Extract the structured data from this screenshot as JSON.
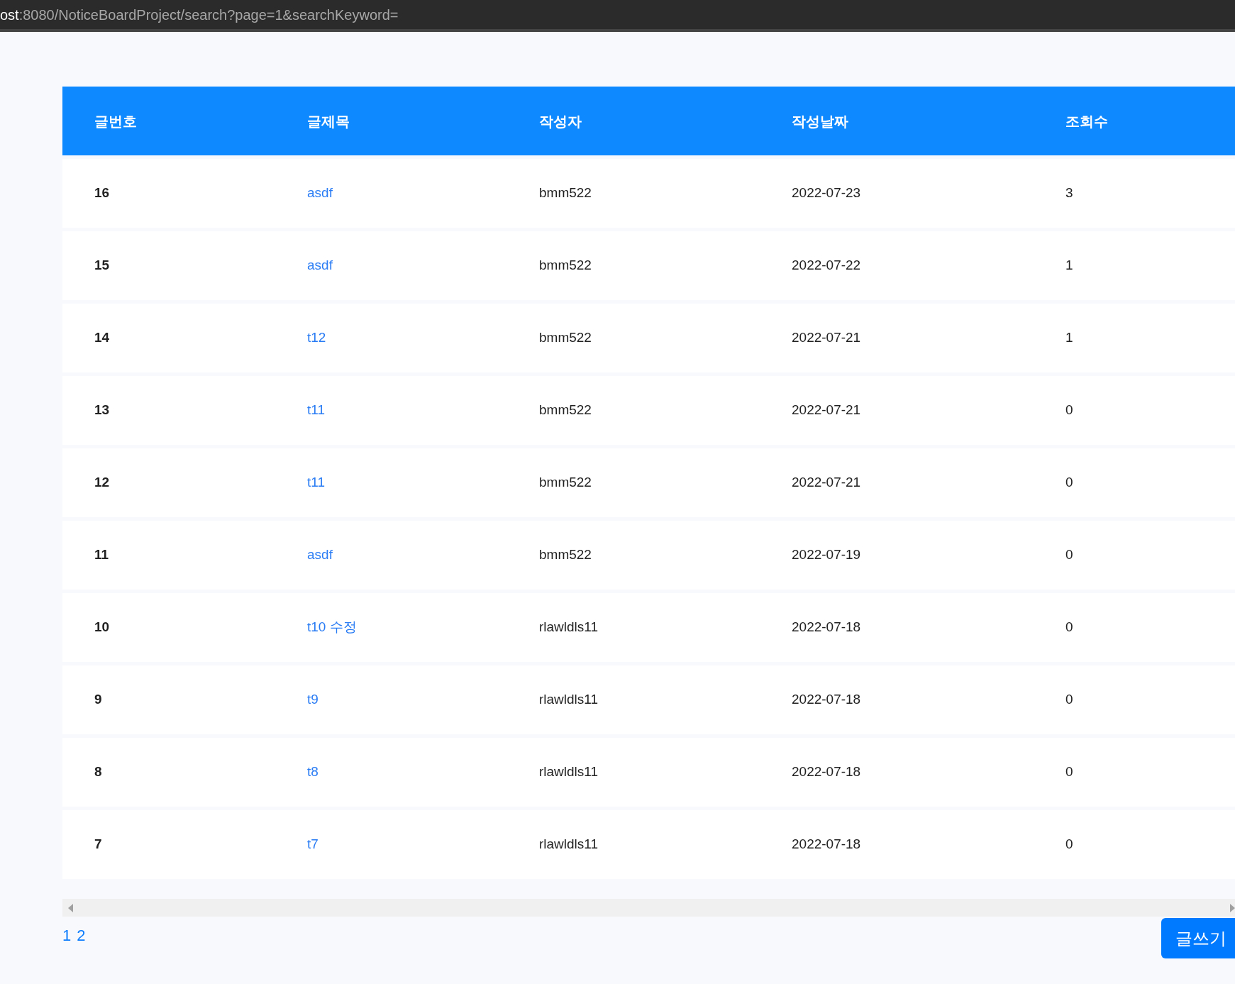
{
  "address_bar": {
    "host": "ost",
    "path": ":8080/NoticeBoardProject/search?page=1&searchKeyword="
  },
  "table": {
    "columns": [
      "글번호",
      "글제목",
      "작성자",
      "작성날짜",
      "조회수"
    ],
    "rows": [
      {
        "number": "16",
        "title": "asdf",
        "author": "bmm522",
        "date": "2022-07-23",
        "views": "3"
      },
      {
        "number": "15",
        "title": "asdf",
        "author": "bmm522",
        "date": "2022-07-22",
        "views": "1"
      },
      {
        "number": "14",
        "title": "t12",
        "author": "bmm522",
        "date": "2022-07-21",
        "views": "1"
      },
      {
        "number": "13",
        "title": "t11",
        "author": "bmm522",
        "date": "2022-07-21",
        "views": "0"
      },
      {
        "number": "12",
        "title": "t11",
        "author": "bmm522",
        "date": "2022-07-21",
        "views": "0"
      },
      {
        "number": "11",
        "title": "asdf",
        "author": "bmm522",
        "date": "2022-07-19",
        "views": "0"
      },
      {
        "number": "10",
        "title": "t10 수정",
        "author": "rlawldls11",
        "date": "2022-07-18",
        "views": "0"
      },
      {
        "number": "9",
        "title": "t9",
        "author": "rlawldls11",
        "date": "2022-07-18",
        "views": "0"
      },
      {
        "number": "8",
        "title": "t8",
        "author": "rlawldls11",
        "date": "2022-07-18",
        "views": "0"
      },
      {
        "number": "7",
        "title": "t7",
        "author": "rlawldls11",
        "date": "2022-07-18",
        "views": "0"
      }
    ]
  },
  "pagination": [
    "1",
    "2"
  ],
  "write_button": "글쓰기"
}
